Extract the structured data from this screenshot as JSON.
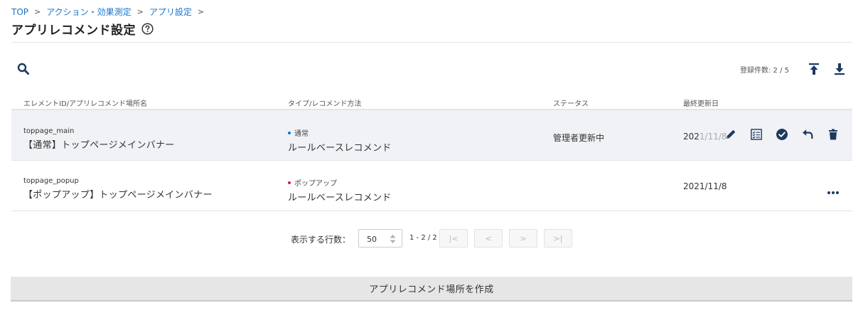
{
  "breadcrumb": {
    "items": [
      "TOP",
      "アクション・効果測定",
      "アプリ設定"
    ],
    "separator": ">"
  },
  "page": {
    "title": "アプリレコメンド設定",
    "help_icon": "question-circle-icon"
  },
  "toolbar": {
    "search_icon": "search-icon",
    "count_label": "登録件数: 2 / 5",
    "import_icon": "upload-icon",
    "export_icon": "download-icon"
  },
  "table": {
    "headers": {
      "element": "エレメントID/アプリレコメンド場所名",
      "type": "タイプ/レコメンド方法",
      "status": "ステータス",
      "updated": "最終更新日"
    },
    "rows": [
      {
        "element_id": "toppage_main",
        "name": "【通常】トップページメインバナー",
        "type": "通常",
        "type_color": "#1a73c8",
        "method": "ルールベースレコメンド",
        "status": "管理者更新中",
        "date_visible": "202",
        "date_faded": "1/11/8",
        "actions": [
          "pencil-icon",
          "list-check-icon",
          "check-circle-icon",
          "undo-icon",
          "trash-icon"
        ]
      },
      {
        "element_id": "toppage_popup",
        "name": "【ポップアップ】トップページメインバナー",
        "type": "ポップアップ",
        "type_color": "#d81b4a",
        "method": "ルールベースレコメンド",
        "status": "",
        "date": "2021/11/8",
        "actions": [
          "more-horizontal-icon"
        ]
      }
    ]
  },
  "pagination": {
    "rows_label": "表示する行数：",
    "rows_value": "50",
    "range": "1 - 2 / 2",
    "first_label": "|<",
    "prev_label": "<",
    "next_label": ">",
    "last_label": ">|"
  },
  "create_button": {
    "label": "アプリレコメンド場所を作成"
  },
  "colors": {
    "link": "#1a73c8",
    "icon_navy": "#1c3a5e",
    "hover_row": "#f0f2f6"
  }
}
